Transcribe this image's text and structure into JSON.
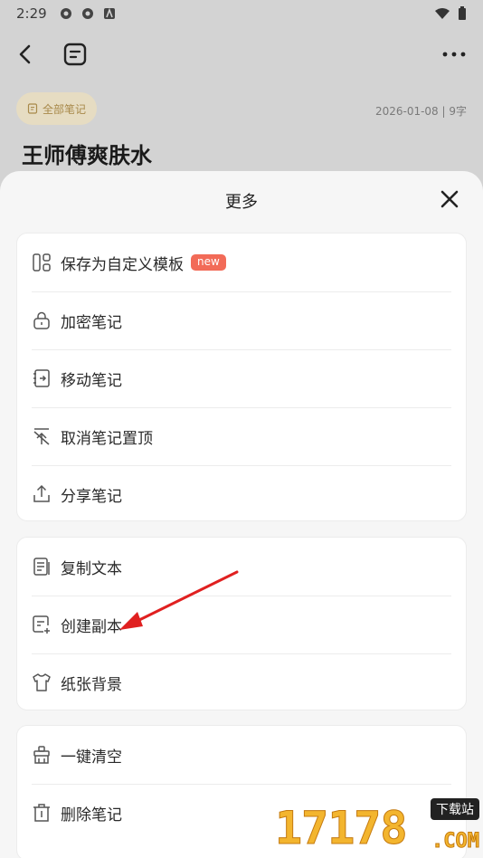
{
  "status_bar": {
    "time": "2:29"
  },
  "note": {
    "tag_label": "全部笔记",
    "meta": "2026-01-08 | 9字",
    "title": "王师傅爽肤水"
  },
  "sheet": {
    "title": "更多",
    "groups": [
      {
        "items": [
          {
            "label": "保存为自定义模板",
            "icon": "template-icon",
            "badge": "new"
          },
          {
            "label": "加密笔记",
            "icon": "lock-icon"
          },
          {
            "label": "移动笔记",
            "icon": "move-icon"
          },
          {
            "label": "取消笔记置顶",
            "icon": "unpin-icon"
          },
          {
            "label": "分享笔记",
            "icon": "share-icon"
          }
        ]
      },
      {
        "items": [
          {
            "label": "复制文本",
            "icon": "copy-text-icon"
          },
          {
            "label": "创建副本",
            "icon": "create-copy-icon"
          },
          {
            "label": "纸张背景",
            "icon": "paper-background-icon"
          }
        ]
      },
      {
        "items": [
          {
            "label": "一键清空",
            "icon": "clear-icon"
          },
          {
            "label": "删除笔记",
            "icon": "trash-icon"
          }
        ]
      }
    ]
  },
  "watermark": {
    "digits": "17178",
    "badge": "下载站",
    "com": ".COM"
  },
  "colors": {
    "accent_badge": "#f26b58",
    "annotation_arrow": "#e02020",
    "tag_text": "#a8894a"
  }
}
